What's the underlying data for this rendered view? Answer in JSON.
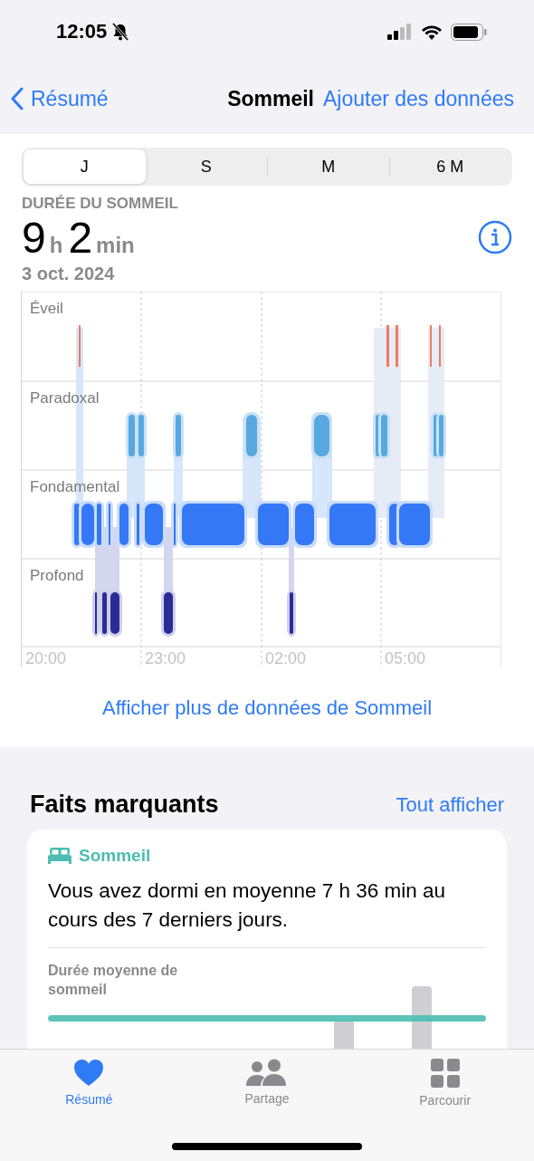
{
  "status_bar": {
    "time": "12:05",
    "silent": true
  },
  "nav": {
    "back": "Résumé",
    "title": "Sommeil",
    "action": "Ajouter des données"
  },
  "periods": [
    {
      "label": "J",
      "selected": true
    },
    {
      "label": "S",
      "selected": false
    },
    {
      "label": "M",
      "selected": false
    },
    {
      "label": "6 M",
      "selected": false
    }
  ],
  "summary": {
    "heading": "DURÉE DU SOMMEIL",
    "hours": "9",
    "hours_unit": "h",
    "minutes": "2",
    "minutes_unit": "min",
    "date": "3 oct. 2024"
  },
  "stages_chart": {
    "stages": [
      "Éveil",
      "Paradoxal",
      "Fondamental",
      "Profond"
    ],
    "times": [
      "20:00",
      "23:00",
      "02:00",
      "05:00"
    ]
  },
  "more_link": "Afficher plus de données de Sommeil",
  "highlights": {
    "title": "Faits marquants",
    "see_all": "Tout afficher",
    "card": {
      "category": "Sommeil",
      "text": "Vous avez dormi en moyenne 7 h 36 min au cours des 7 derniers jours.",
      "metric_label": "Durée moyenne de sommeil"
    }
  },
  "tab_bar": [
    {
      "label": "Résumé",
      "selected": true,
      "kind": "heart"
    },
    {
      "label": "Partage",
      "selected": false,
      "kind": "people"
    },
    {
      "label": "Parcourir",
      "selected": false,
      "kind": "grid"
    }
  ]
}
